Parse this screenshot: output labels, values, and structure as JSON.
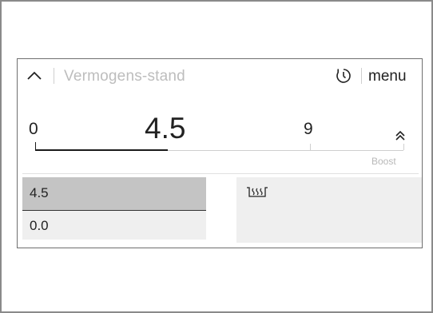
{
  "header": {
    "title": "Vermogens-stand",
    "menu_label": "menu",
    "icons": {
      "collapse": "chevron-up-icon",
      "timer": "timer-icon"
    }
  },
  "slider": {
    "min_label": "0",
    "current_value": "4.5",
    "max_label": "9",
    "boost_label": "Boost",
    "level": 0.5,
    "icons": {
      "boost": "double-chevron-up-icon"
    }
  },
  "options": {
    "items": [
      {
        "label": "4.5",
        "selected": true
      },
      {
        "label": "0.0",
        "selected": false
      }
    ]
  },
  "heating_zone": {
    "icon": "heating-zone-icon"
  },
  "colors": {
    "active_track": "#1a1a1a",
    "selected_item": "#c4c4c4",
    "tile": "#efefef",
    "title_text": "#bdbdbd"
  }
}
